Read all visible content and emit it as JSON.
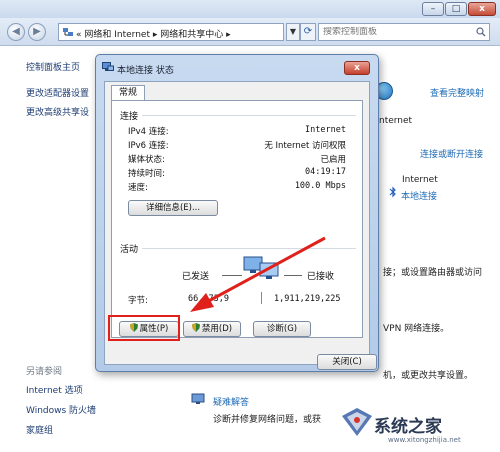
{
  "explorer": {
    "window_controls": {
      "minimize": "–",
      "maximize": "□",
      "close": "x"
    },
    "address": {
      "prefix": "«",
      "crumbs": [
        "网络和 Internet",
        "网络和共享中心"
      ],
      "separator": "▸"
    },
    "search": {
      "placeholder": "搜索控制面板"
    }
  },
  "left_pane": {
    "home": "控制面板主页",
    "links": [
      "更改适配器设置",
      "更改高级共享设"
    ],
    "see_also_heading": "另请参阅",
    "see_also": [
      "Internet 选项",
      "Windows 防火墙",
      "家庭组"
    ]
  },
  "main": {
    "full_map_link": "查看完整映射",
    "internet_label_1": "nternet",
    "connect_disconnect_link": "连接或断开连接",
    "internet_label_2": "Internet",
    "local_connection_link": "本地连接",
    "text_router": "接；或设置路由器或访问",
    "text_vpn": "VPN 网络连接。",
    "text_sharing": "机，或更改共享设置。",
    "troubleshoot_link": "疑难解答",
    "troubleshoot_desc": "诊断并修复网络问题，或获"
  },
  "dialog": {
    "title": "本地连接 状态",
    "close": "x",
    "tab": "常规",
    "connection_section": "连接",
    "rows": [
      {
        "label": "IPv4 连接:",
        "value": "Internet"
      },
      {
        "label": "IPv6 连接:",
        "value": "无 Internet 访问权限"
      },
      {
        "label": "媒体状态:",
        "value": "已启用"
      },
      {
        "label": "持续时间:",
        "value": "04:19:17"
      },
      {
        "label": "速度:",
        "value": "100.0 Mbps"
      }
    ],
    "details_button": "详细信息(E)...",
    "activity_section": "活动",
    "sent_label": "已发送",
    "received_label": "已接收",
    "bytes_label": "字节:",
    "bytes_sent": "66,173,9",
    "bytes_received": "1,911,219,225",
    "properties_button": "属性(P)",
    "disable_button": "禁用(D)",
    "diagnose_button": "诊断(G)",
    "close_button": "关闭(C)"
  },
  "watermark": {
    "text": "系统之家",
    "url": "www.xitongzhijia.net"
  },
  "colors": {
    "annotation": "#e0201a",
    "link": "#1f6bb5",
    "dialog_frame": "#b3cbe8"
  }
}
